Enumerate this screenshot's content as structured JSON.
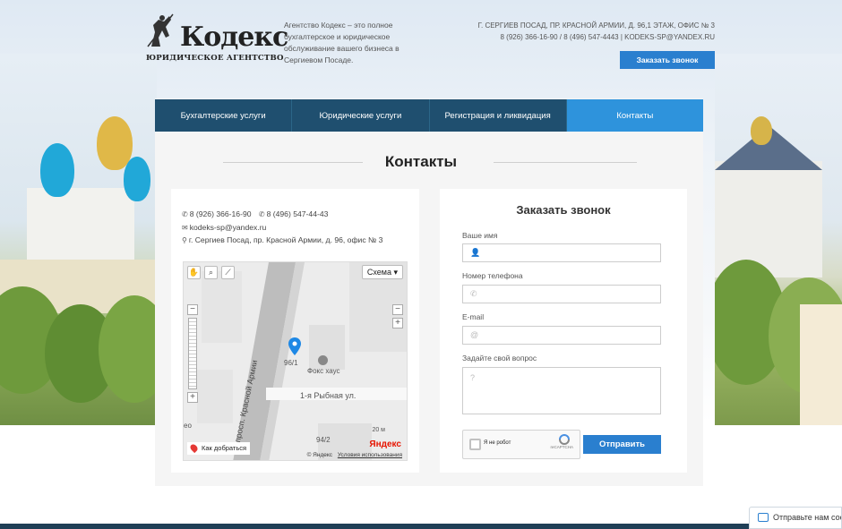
{
  "header": {
    "logo_name": "Кодекс",
    "logo_sub": "ЮРИДИЧЕСКОЕ АГЕНТСТВО",
    "tagline": "Агентство Кодекс – это полное бухгалтерское и юридическое обслуживание вашего бизнеса в Сергиевом Посаде.",
    "address_line": "Г. СЕРГИЕВ ПОСАД, ПР. КРАСНОЙ АРМИИ, Д. 96,1 ЭТАЖ, ОФИС № 3",
    "phones_line": "8 (926) 366-16-90 / 8 (496) 547-4443 | KODEKS-SP@YANDEX.RU",
    "callback_label": "Заказать звонок"
  },
  "nav": {
    "items": [
      {
        "label": "Бухгалтерские услуги"
      },
      {
        "label": "Юридические услуги"
      },
      {
        "label": "Регистрация и ликвидация"
      },
      {
        "label": "Контакты"
      }
    ]
  },
  "page": {
    "title": "Контакты"
  },
  "contacts": {
    "phone1": "8 (926) 366-16-90",
    "phone2": "8 (496) 547-44-43",
    "email": "kodeks-sp@yandex.ru",
    "address": "г. Сергиев Посад, пр. Красной Армии, д. 96, офис № 3"
  },
  "map": {
    "scheme_label": "Схема ▾",
    "street_main": "просп. Красной Армии",
    "street_side": "1-я Рыбная ул.",
    "building1": "96/1",
    "building2": "94/2",
    "poi": "Фокс хаус",
    "route_label": "Как добраться",
    "scale": "20 м",
    "brand": "Яндекс",
    "copyright": "© Яндекс",
    "terms": "Условия использования",
    "edge_label": "ео"
  },
  "form": {
    "title": "Заказать звонок",
    "name_label": "Ваше имя",
    "phone_label": "Номер телефона",
    "email_label": "E-mail",
    "question_label": "Задайте свой вопрос",
    "question_placeholder": "?",
    "captcha_label": "Я не робот",
    "captcha_brand": "reCAPTCHA",
    "submit_label": "Отправить"
  },
  "chat": {
    "label": "Отправьте нам сооб"
  },
  "colors": {
    "accent": "#2a7fcf",
    "nav_bg": "#1f4f6f",
    "nav_active": "#2e93dc"
  }
}
